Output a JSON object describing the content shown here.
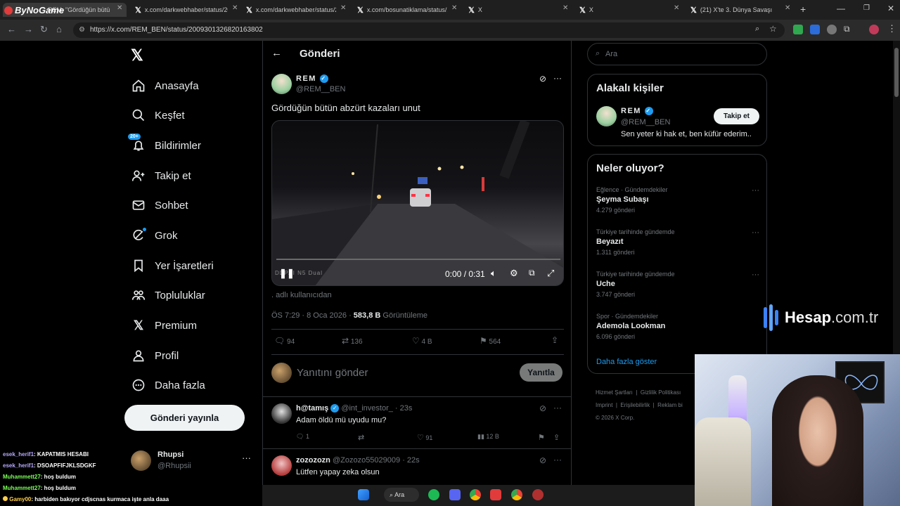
{
  "browser": {
    "tabs": [
      {
        "title": "REM: \"Gördüğün bütü"
      },
      {
        "title": "x.com/darkwebhaber/status/20"
      },
      {
        "title": "x.com/darkwebhaber/status/20"
      },
      {
        "title": "x.com/bosunatiklama/status/20"
      },
      {
        "title": "X"
      },
      {
        "title": "X"
      },
      {
        "title": "(21) X'te 3. Dünya Savaşı"
      }
    ],
    "overlay_logo": "ByNoGame",
    "url": "https://x.com/REM_BEN/status/2009301326820163802"
  },
  "sidebar": {
    "items": [
      {
        "label": "Anasayfa",
        "icon": "home-icon"
      },
      {
        "label": "Keşfet",
        "icon": "search-icon"
      },
      {
        "label": "Bildirimler",
        "icon": "bell-icon",
        "badge": "20+"
      },
      {
        "label": "Takip et",
        "icon": "follow-icon"
      },
      {
        "label": "Sohbet",
        "icon": "mail-icon"
      },
      {
        "label": "Grok",
        "icon": "grok-icon"
      },
      {
        "label": "Yer İşaretleri",
        "icon": "bookmark-icon"
      },
      {
        "label": "Topluluklar",
        "icon": "communities-icon"
      },
      {
        "label": "Premium",
        "icon": "x-logo-icon"
      },
      {
        "label": "Profil",
        "icon": "profile-icon"
      },
      {
        "label": "Daha fazla",
        "icon": "more-icon"
      }
    ],
    "post_button": "Gönderi yayınla",
    "account": {
      "name": "Rhupsi",
      "handle": "@Rhupsii"
    }
  },
  "header": {
    "title": "Gönderi"
  },
  "post": {
    "author_name": "REM",
    "author_handle": "@REM__BEN",
    "text": "Gördüğün bütün abzürt kazaları unut",
    "video": {
      "time": "0:00 / 0:31",
      "watermark": "DDPAI N5 Dual",
      "progress": 0.0
    },
    "source": ". adlı kullanıcıdan",
    "time": "ÖS 7:29 · 8 Oca 2026 · ",
    "views": "583,8 B",
    "views_label": "Görüntüleme",
    "stats": {
      "replies": "94",
      "reposts": "136",
      "likes": "4 B",
      "bookmarks": "564"
    }
  },
  "reply_box": {
    "placeholder": "Yanıtını gönder",
    "button": "Yanıtla"
  },
  "replies": [
    {
      "name": "h@tamış",
      "handle": "@int_investor_",
      "time": "· 23s",
      "text": "Adam öldü mü uyudu mu?",
      "replies": "1",
      "likes": "91",
      "views": "12 B"
    },
    {
      "name": "zozozozn",
      "handle": "@Zozozo55029009",
      "time": "· 22s",
      "text": "Lütfen yapay zeka olsun"
    }
  ],
  "search": {
    "placeholder": "Ara"
  },
  "related": {
    "title": "Alakalı kişiler",
    "name": "REM",
    "handle": "@REM__BEN",
    "follow": "Takip et",
    "bio": "Sen yeter ki hak et, ben küfür ederim.."
  },
  "trends": {
    "title": "Neler oluyor?",
    "items": [
      {
        "category": "Eğlence · Gündemdekiler",
        "name": "Şeyma Subaşı",
        "count": "4.279 gönderi"
      },
      {
        "category": "Türkiye tarihinde gündemde",
        "name": "Beyazıt",
        "count": "1.311 gönderi"
      },
      {
        "category": "Türkiye tarihinde gündemde",
        "name": "Uche",
        "count": "3.747 gönderi"
      },
      {
        "category": "Spor · Gündemdekiler",
        "name": "Ademola Lookman",
        "count": "6.096 gönderi"
      }
    ],
    "more": "Daha fazla göster"
  },
  "footer": {
    "links": [
      "Hizmet Şartları",
      "Gizlilik Politikası",
      "Imprint",
      "Erişilebilirlik",
      "Reklam bi"
    ],
    "copyright": "© 2026 X Corp."
  },
  "sponsor": {
    "brand": "Hesap",
    "domain": ".com.tr"
  },
  "chat": [
    {
      "user": "esek_herif1",
      "msg": ": KAPATMIS HESABI",
      "color": "#b8a9ff"
    },
    {
      "user": "esek_herif1",
      "msg": ": DSOAPFIFJKLSDGKF",
      "color": "#b8a9ff"
    },
    {
      "user": "Muhammett27",
      "msg": ": hoş buldum",
      "color": "#7cff5a"
    },
    {
      "user": "Muhammett27",
      "msg": ": hoş buldum",
      "color": "#7cff5a"
    },
    {
      "user": "Gamy00",
      "msg": ": harbiden bakıyor cdjscnas kurmaca işte anla daaa",
      "color": "#ffcf4a"
    }
  ],
  "taskbar": {
    "search": "Ara"
  }
}
